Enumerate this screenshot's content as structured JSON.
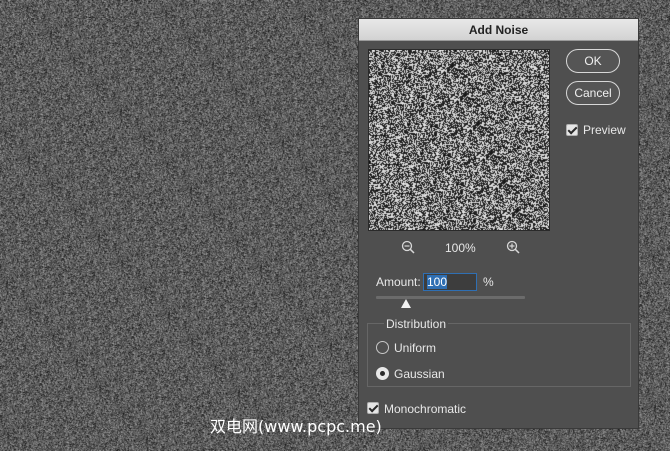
{
  "dialog": {
    "title": "Add Noise",
    "ok_label": "OK",
    "cancel_label": "Cancel",
    "preview_label": "Preview",
    "preview_checked": true,
    "zoom_level": "100%",
    "amount_label": "Amount:",
    "amount_value": "100",
    "amount_unit": "%",
    "amount_slider_fraction": 0.2,
    "distribution": {
      "legend": "Distribution",
      "options": [
        {
          "label": "Uniform",
          "selected": false
        },
        {
          "label": "Gaussian",
          "selected": true
        }
      ]
    },
    "monochromatic_label": "Monochromatic",
    "monochromatic_checked": true
  },
  "icons": {
    "zoom_out": "zoom-out-icon",
    "zoom_in": "zoom-in-icon"
  },
  "watermark": "双电网(www.pcpc.me)",
  "colors": {
    "background": "#5d5d5d",
    "dialog": "#4f4f4f",
    "accent": "#2f6fb3"
  }
}
